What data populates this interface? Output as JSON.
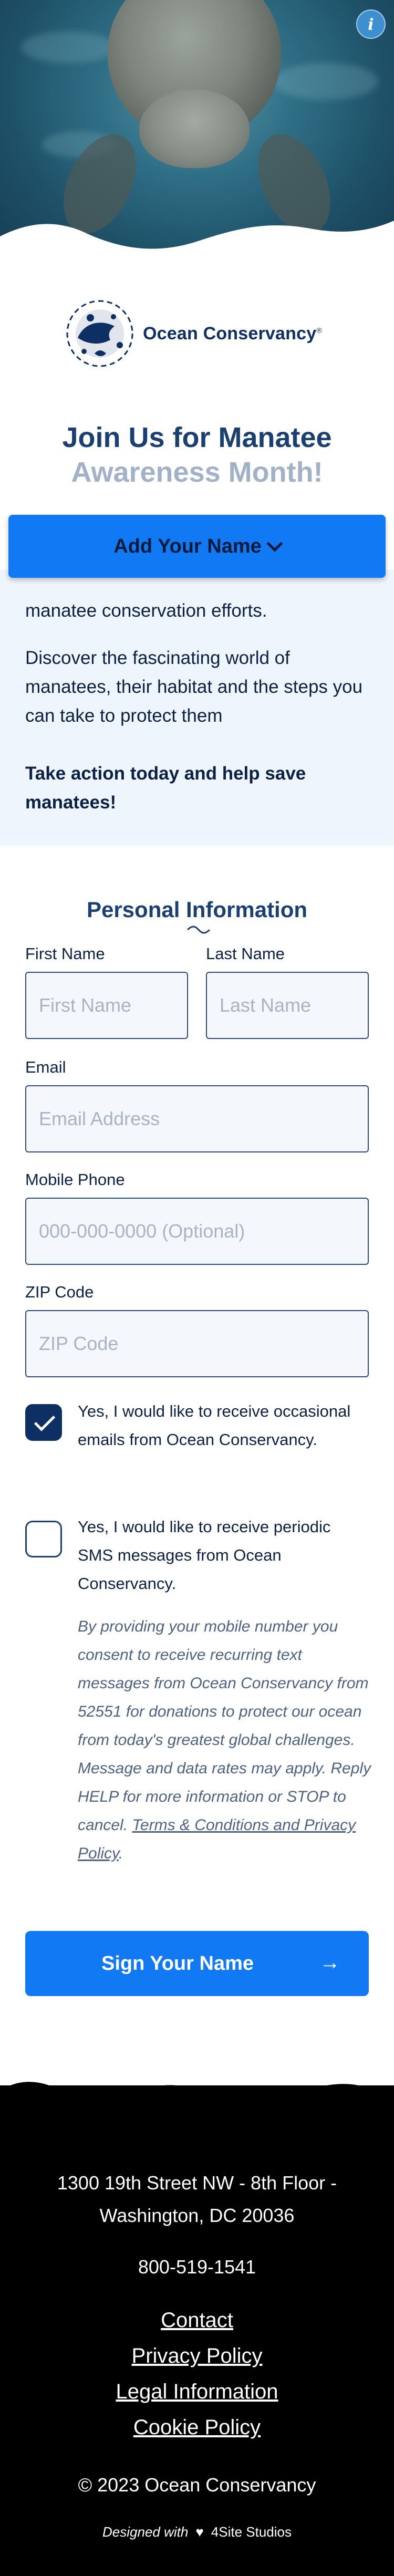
{
  "hero": {
    "info_label": "i"
  },
  "logo": {
    "name": "Ocean Conservancy",
    "mark": "®"
  },
  "title": {
    "line1": "Join Us for Manatee",
    "line2": "Awareness Month!"
  },
  "sticky_button": {
    "label": "Add Your Name"
  },
  "intro": {
    "p1": "manatee conservation efforts.",
    "p2": "Discover the fascinating world of manatees, their habitat and the steps you can take to protect them",
    "p3": "Take action today and help save manatees!"
  },
  "form": {
    "section_title": "Personal Information",
    "first_name_label": "First Name",
    "first_name_placeholder": "First Name",
    "last_name_label": "Last Name",
    "last_name_placeholder": "Last Name",
    "email_label": "Email",
    "email_placeholder": "Email Address",
    "phone_label": "Mobile Phone",
    "phone_placeholder": "000-000-0000 (Optional)",
    "zip_label": "ZIP Code",
    "zip_placeholder": "ZIP Code",
    "email_optin": {
      "label": "Yes, I would like to receive occasional emails from Ocean Conservancy.",
      "checked": true
    },
    "sms_optin": {
      "label": "Yes, I would like to receive periodic SMS messages from Ocean Conservancy.",
      "checked": false
    },
    "disclaimer": "By providing your mobile number you consent to receive recurring text messages from Ocean Conservancy from 52551 for donations to protect our ocean from today's greatest global challenges. Message and data rates may apply. Reply HELP for more information or STOP to cancel.",
    "terms_link": "Terms & Conditions and Privacy Policy",
    "submit_label": "Sign Your Name",
    "submit_arrow": "→"
  },
  "footer": {
    "address_line1": "1300 19th Street NW - 8th Floor -",
    "address_line2": "Washington, DC 20036",
    "phone": "800-519-1541",
    "links": [
      "Contact",
      "Privacy Policy",
      "Legal Information",
      "Cookie Policy"
    ],
    "copyright": "© 2023 Ocean Conservancy",
    "designed_with": "Designed with",
    "heart": "♥",
    "studio": "4Site Studios"
  },
  "colors": {
    "primary_blue": "#1279f5",
    "navy": "#0d2f63",
    "intro_bg": "#eef5fd",
    "footer_bg": "#000000"
  }
}
